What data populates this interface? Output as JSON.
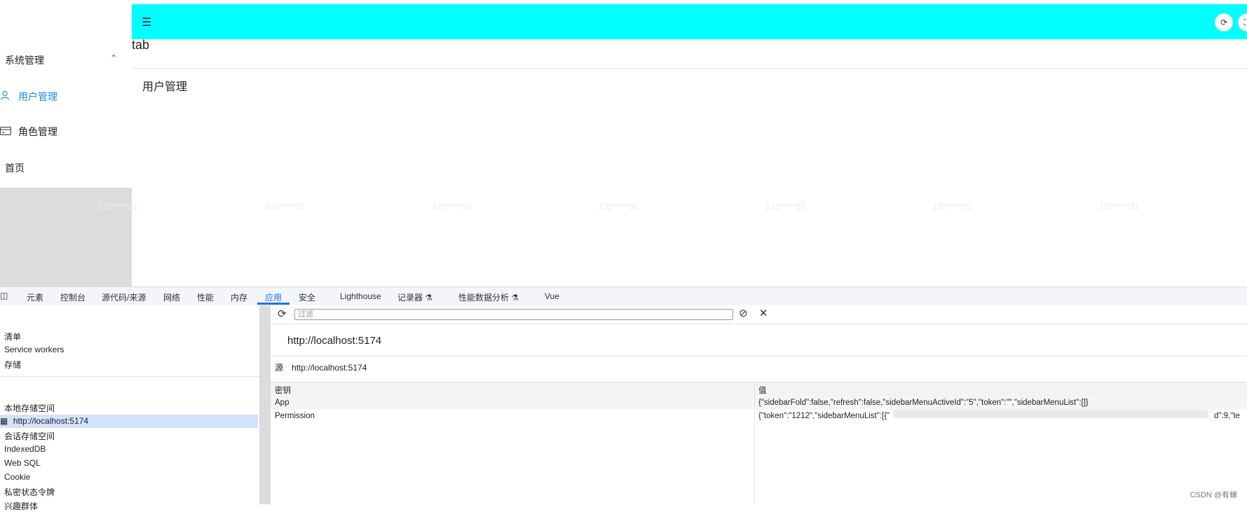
{
  "app": {
    "tab_label": "tab",
    "page_title": "用户管理",
    "topbar_color": "#00ffff",
    "sidebar": {
      "group_label": "系统管理",
      "items": [
        {
          "label": "用户管理",
          "icon": "user-icon",
          "active": true
        },
        {
          "label": "角色管理",
          "icon": "card-icon",
          "active": false
        },
        {
          "label": "首页",
          "icon": "",
          "active": false
        }
      ]
    },
    "topbar_icons": [
      "refresh-icon",
      "fullscreen-icon"
    ]
  },
  "watermark_text": "135*****31",
  "devtools": {
    "tabs": [
      "元素",
      "控制台",
      "源代码/来源",
      "网络",
      "性能",
      "内存",
      "应用",
      "安全",
      "Lighthouse",
      "记录器 ⚗",
      "性能数据分析 ⚗",
      "Vue"
    ],
    "active_tab": "应用",
    "sidebar": {
      "section1": [
        "清单",
        "Service workers",
        "存储"
      ],
      "section2": [
        "本地存储空间",
        "http://localhost:5174",
        "会话存储空间",
        "IndexedDB",
        "Web SQL",
        "Cookie",
        "私密状态令牌",
        "兴趣群体"
      ],
      "selected": "http://localhost:5174"
    },
    "filter_placeholder": "过滤",
    "origin_title": "http://localhost:5174",
    "origin_label": "源",
    "origin_value": "http://localhost:5174",
    "table": {
      "headers": [
        "密钥",
        "值"
      ],
      "rows": [
        {
          "key": "App",
          "value": "{\"sidebarFold\":false,\"refresh\":false,\"sidebarMenuActiveId\":\"5\",\"token\":\"\",\"sidebarMenuList\":[]}"
        },
        {
          "key": "Permission",
          "value": "{\"token\":\"1212\",\"sidebarMenuList\":[{\"",
          "value_tail": "d\":9,\"te"
        }
      ]
    }
  },
  "footer_credit": "CSDN @有蝉"
}
